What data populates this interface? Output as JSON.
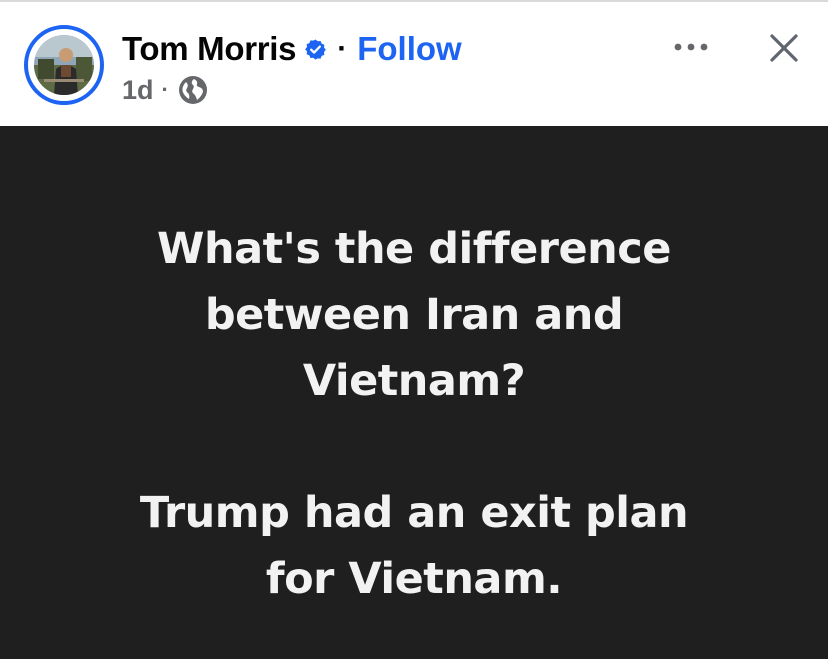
{
  "header": {
    "author_name": "Tom Morris",
    "separator": "·",
    "follow_label": "Follow",
    "time": "1d",
    "meta_separator": "·",
    "icons": {
      "avatar": "profile-photo",
      "verified": "verified-badge-icon",
      "audience": "globe-icon",
      "more": "more-options-icon",
      "close": "close-icon"
    },
    "colors": {
      "accent": "#1d64f2",
      "text": "#050505",
      "muted": "#65676b"
    }
  },
  "post": {
    "background": "#1f1f1f",
    "text_color": "#f2f2f2",
    "lines_top": [
      "What's the difference",
      "between Iran and",
      "Vietnam?"
    ],
    "lines_bottom": [
      "Trump had an exit plan",
      "for Vietnam."
    ]
  }
}
